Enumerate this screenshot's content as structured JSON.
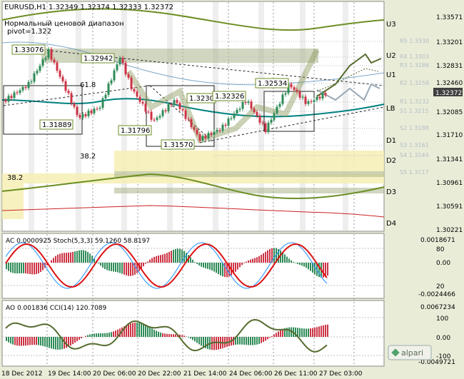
{
  "header": {
    "symbol": "EURUSD,H1",
    "ohlc": "1.32349 1.32374 1.32333 1.32372",
    "indicator_name": "Нормальный ценовой диапазон",
    "pivot": "pivot=1.322"
  },
  "price_axis": {
    "ticks": [
      "1.33571",
      "1.33201",
      "1.32831",
      "1.32460",
      "1.32085",
      "1.31710",
      "1.31341",
      "1.30961",
      "1.30591",
      "1.30221"
    ],
    "current_price": "1.32372"
  },
  "levels": {
    "right_labels": [
      "U3",
      "U2",
      "U1",
      "LB",
      "D1",
      "D2",
      "D3",
      "D4"
    ],
    "pivot_labels": [
      "R5 1.3330",
      "R4 1.3303",
      "R3 1.3286",
      "R2 1.3258",
      "R1 1.3232",
      "S1 1.3215",
      "S2 1.3188",
      "S3 1.3161",
      "S4 1.3144",
      "S5 1.3117"
    ]
  },
  "price_labels": [
    "1.33076",
    "1.32942",
    "1.31889",
    "1.31796",
    "1.31570",
    "1.3230",
    "1.32326",
    "1.32534"
  ],
  "fib_labels": [
    "61.8",
    "38.2",
    "38.2"
  ],
  "sub1": {
    "title": "AC 0.0000925  Stoch(5,3,3) 59.1260 58.8197",
    "ticks": [
      "0.0018671",
      "80",
      "0.00",
      "20",
      "-0.0024466"
    ]
  },
  "sub2": {
    "title": "AO 0.001836  CCI(14) 120.7089",
    "ticks": [
      "0.0067234",
      "100",
      "0.00",
      "-100",
      "-0.0049721"
    ]
  },
  "time_axis": [
    "18 Dec 2012",
    "19 Dec 14:00",
    "20 Dec 06:00",
    "20 Dec 22:00",
    "21 Dec 14:00",
    "24 Dec 06:00",
    "26 Dec 11:00",
    "27 Dec 03:00"
  ],
  "brand": "alpari",
  "colors": {
    "background": "#e9edd8",
    "olive": "#6b8e23",
    "teal": "#008080",
    "bull_bar": "#2e8b57",
    "bear_bar": "#cc3344",
    "price_tag": "#404040"
  }
}
